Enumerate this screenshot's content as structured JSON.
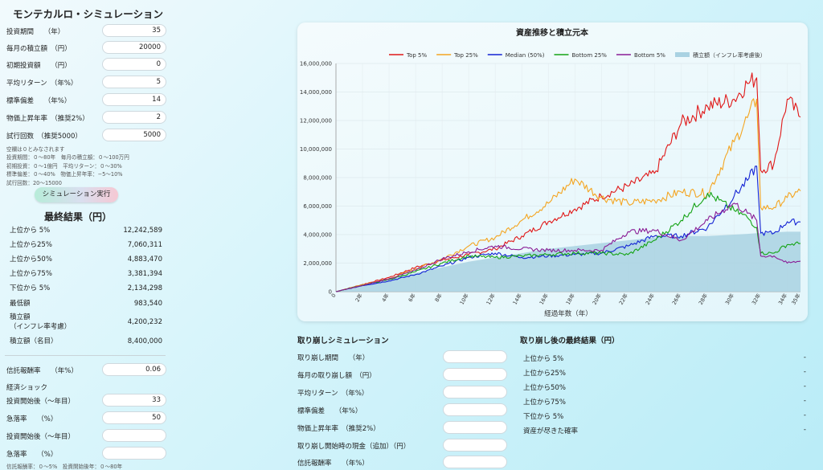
{
  "app_title": "モンテカルロ・シミュレーション",
  "inputs": [
    {
      "label": "投資期間　　（年）",
      "value": "35"
    },
    {
      "label": "毎月の積立額　（円）",
      "value": "20000"
    },
    {
      "label": "初期投資額　　（円）",
      "value": "0"
    },
    {
      "label": "平均リターン　（年%）",
      "value": "5"
    },
    {
      "label": "標準偏差　　（年%）",
      "value": "14"
    },
    {
      "label": "物価上昇年率　（推奨2%）",
      "value": "2"
    },
    {
      "label": "試行回数　（推奨5000）",
      "value": "5000"
    }
  ],
  "hints": [
    "空欄は０とみなされます",
    "投資期間：０〜80年　毎月の積立額：０〜100万円",
    "初期投資：０〜1億円　平均リターン：０〜30%",
    "標準偏差：０〜40%　物価上昇年率：−5〜10%",
    "試行回数：20〜15000"
  ],
  "run_button": "シミュレーション実行",
  "results_title": "最終結果（円）",
  "results": [
    {
      "label": "上位から 5%",
      "value": "12,242,589"
    },
    {
      "label": "上位から25%",
      "value": "7,060,311"
    },
    {
      "label": "上位から50%",
      "value": "4,883,470"
    },
    {
      "label": "上位から75%",
      "value": "3,381,394"
    },
    {
      "label": "下位から 5%",
      "value": "2,134,298"
    },
    {
      "label": "最低額",
      "value": "983,540"
    },
    {
      "label": "積立額\n（インフレ率考慮）",
      "value": "4,200,232"
    },
    {
      "label": "積立額（名目）",
      "value": "8,400,000"
    }
  ],
  "fee_inputs": [
    {
      "label": "信託報酬率　　（年%）",
      "value": "0.06"
    }
  ],
  "shock_label": "経済ショック",
  "shock_inputs": [
    {
      "label": "投資開始後（〜年目）",
      "value": "33"
    },
    {
      "label": "急落率　　（%）",
      "value": "50"
    },
    {
      "label": "投資開始後（〜年目）",
      "value": ""
    },
    {
      "label": "急落率　　（%）",
      "value": ""
    }
  ],
  "bottom_hint": "信託報酬率：０〜5%　投資開始後年：０〜80年",
  "chart": {
    "title": "資産推移と積立元本",
    "xlabel": "経過年数（年）",
    "legend": [
      {
        "name": "Top 5%",
        "color": "#e01818"
      },
      {
        "name": "Top 25%",
        "color": "#f4a521"
      },
      {
        "name": "Median (50%)",
        "color": "#1323d4"
      },
      {
        "name": "Bottom 25%",
        "color": "#14a314"
      },
      {
        "name": "Bottom 5%",
        "color": "#8a1d96"
      },
      {
        "name": "積立額（インフレ率考慮後）",
        "color": "#a9d2e2"
      }
    ],
    "y_ticks": [
      "0",
      "2,000,000",
      "4,000,000",
      "6,000,000",
      "8,000,000",
      "10,000,000",
      "12,000,000",
      "14,000,000",
      "16,000,000"
    ],
    "x_ticks": [
      "0",
      "2年",
      "4年",
      "6年",
      "8年",
      "10年",
      "12年",
      "14年",
      "16年",
      "18年",
      "20年",
      "22年",
      "24年",
      "26年",
      "28年",
      "30年",
      "32年",
      "34年",
      "35年"
    ]
  },
  "chart_data": {
    "type": "line",
    "title": "資産推移と積立元本",
    "xlabel": "経過年数（年）",
    "ylabel": "",
    "ylim": [
      0,
      16000000
    ],
    "xlim": [
      0,
      35
    ],
    "x": [
      0,
      2,
      4,
      6,
      8,
      10,
      12,
      14,
      16,
      18,
      20,
      22,
      24,
      26,
      28,
      30,
      31,
      31.7,
      32,
      33,
      34,
      35
    ],
    "series": [
      {
        "name": "Top 5%",
        "values": [
          0,
          500000,
          1000000,
          1700000,
          2200000,
          2600000,
          3000000,
          3900000,
          4900000,
          5800000,
          6700000,
          7400000,
          8300000,
          11800000,
          13000000,
          13500000,
          14600000,
          15000000,
          8500000,
          9000000,
          13500000,
          12242589
        ]
      },
      {
        "name": "Top 25%",
        "values": [
          0,
          480000,
          900000,
          1600000,
          2300000,
          3200000,
          3800000,
          5000000,
          6200000,
          7900000,
          6600000,
          6200000,
          6400000,
          7000000,
          6900000,
          10500000,
          12200000,
          13500000,
          5900000,
          5900000,
          6600000,
          7060311
        ]
      },
      {
        "name": "Median (50%)",
        "values": [
          0,
          420000,
          750000,
          1200000,
          1800000,
          2400000,
          2700000,
          2400000,
          2500000,
          2600000,
          2700000,
          3200000,
          3900000,
          3900000,
          4500000,
          6700000,
          7800000,
          8800000,
          4100000,
          4100000,
          4900000,
          4883470
        ]
      },
      {
        "name": "Bottom 25%",
        "values": [
          0,
          450000,
          850000,
          1400000,
          2000000,
          2500000,
          2400000,
          2500000,
          2600000,
          2700000,
          2700000,
          2600000,
          3600000,
          5000000,
          6900000,
          5700000,
          5200000,
          4500000,
          2700000,
          2700000,
          3300000,
          3381394
        ]
      },
      {
        "name": "Bottom 5%",
        "values": [
          0,
          430000,
          900000,
          1500000,
          2300000,
          2800000,
          3200000,
          3000000,
          2900000,
          2900000,
          2900000,
          4200000,
          4300000,
          3600000,
          5000000,
          6200000,
          5500000,
          5000000,
          2500000,
          2500000,
          2000000,
          2134298
        ]
      },
      {
        "name": "積立額（インフレ率考慮後）",
        "values": [
          0,
          460000,
          900000,
          1300000,
          1700000,
          2100000,
          2400000,
          2700000,
          3000000,
          3200000,
          3400000,
          3600000,
          3800000,
          3900000,
          3900000,
          4000000,
          4050000,
          4100000,
          4100000,
          4150000,
          4200000,
          4200232
        ]
      }
    ]
  },
  "withdraw": {
    "title": "取り崩しシミュレーション",
    "inputs": [
      {
        "label": "取り崩し期間　　（年）",
        "value": ""
      },
      {
        "label": "毎月の取り崩し額　（円）",
        "value": ""
      },
      {
        "label": "平均リターン　（年%）",
        "value": ""
      },
      {
        "label": "標準偏差　　（年%）",
        "value": ""
      },
      {
        "label": "物価上昇年率　（推奨2%）",
        "value": ""
      },
      {
        "label": "取り崩し開始時の現金（追加）（円）",
        "value": ""
      },
      {
        "label": "信託報酬率　　（年%）",
        "value": ""
      }
    ],
    "results_title": "取り崩し後の最終結果（円）",
    "results": [
      {
        "label": "上位から 5%",
        "value": "-"
      },
      {
        "label": "上位から25%",
        "value": "-"
      },
      {
        "label": "上位から50%",
        "value": "-"
      },
      {
        "label": "上位から75%",
        "value": "-"
      },
      {
        "label": "下位から 5%",
        "value": "-"
      },
      {
        "label": "資産が尽きた確率",
        "value": "-"
      }
    ]
  }
}
